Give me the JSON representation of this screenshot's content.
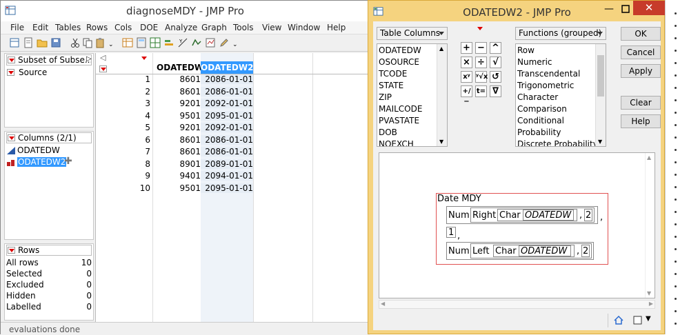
{
  "main_window": {
    "title": "diagnoseMDY - JMP Pro",
    "menu": [
      "File",
      "Edit",
      "Tables",
      "Rows",
      "Cols",
      "DOE",
      "Analyze",
      "Graph",
      "Tools",
      "View",
      "Window",
      "Help"
    ],
    "status": "evaluations done"
  },
  "left_panels": {
    "tables_header": "Subset of Subse...",
    "source_label": "Source",
    "columns_header": "Columns (2/1)",
    "columns": [
      "ODATEDW",
      "ODATEDW2"
    ],
    "rows_header": "Rows",
    "row_stats": [
      {
        "label": "All rows",
        "value": "10"
      },
      {
        "label": "Selected",
        "value": "0"
      },
      {
        "label": "Excluded",
        "value": "0"
      },
      {
        "label": "Hidden",
        "value": "0"
      },
      {
        "label": "Labelled",
        "value": "0"
      }
    ]
  },
  "table": {
    "headers": [
      "ODATEDW",
      "ODATEDW2"
    ],
    "rows": [
      [
        "1",
        "8601",
        "2086-01-01"
      ],
      [
        "2",
        "8601",
        "2086-01-01"
      ],
      [
        "3",
        "9201",
        "2092-01-01"
      ],
      [
        "4",
        "9501",
        "2095-01-01"
      ],
      [
        "5",
        "9201",
        "2092-01-01"
      ],
      [
        "6",
        "8601",
        "2086-01-01"
      ],
      [
        "7",
        "8601",
        "2086-01-01"
      ],
      [
        "8",
        "8901",
        "2089-01-01"
      ],
      [
        "9",
        "9401",
        "2094-01-01"
      ],
      [
        "10",
        "9501",
        "2095-01-01"
      ]
    ]
  },
  "dialog": {
    "title": "ODATEDW2 - JMP Pro",
    "table_columns_combo": "Table Columns",
    "functions_combo": "Functions (grouped)",
    "column_list": [
      "ODATEDW",
      "OSOURCE",
      "TCODE",
      "STATE",
      "ZIP",
      "MAILCODE",
      "PVASTATE",
      "DOB",
      "NOEXCH"
    ],
    "function_list": [
      "Row",
      "Numeric",
      "Transcendental",
      "Trigonometric",
      "Character",
      "Comparison",
      "Conditional",
      "Probability",
      "Discrete Probability"
    ],
    "keypad": [
      "+",
      "−",
      "^",
      "×",
      "÷",
      "√",
      "xʸ",
      "ʸ√x",
      "↺",
      "+/−",
      "t=",
      "∇"
    ],
    "buttons": {
      "ok": "OK",
      "cancel": "Cancel",
      "apply": "Apply",
      "clear": "Clear",
      "help": "Help"
    },
    "formula": {
      "fn": "Date MDY",
      "num1": "Num",
      "right": "Right",
      "char1": "Char",
      "col1": "ODATEDW",
      "n1": "2",
      "comma1": ",",
      "one": "1",
      "comma2": ",",
      "num2": "Num",
      "left": "Left",
      "char2": "Char",
      "col2": "ODATEDW",
      "n2": "2",
      "comma3": ",",
      "comma4": ","
    }
  }
}
